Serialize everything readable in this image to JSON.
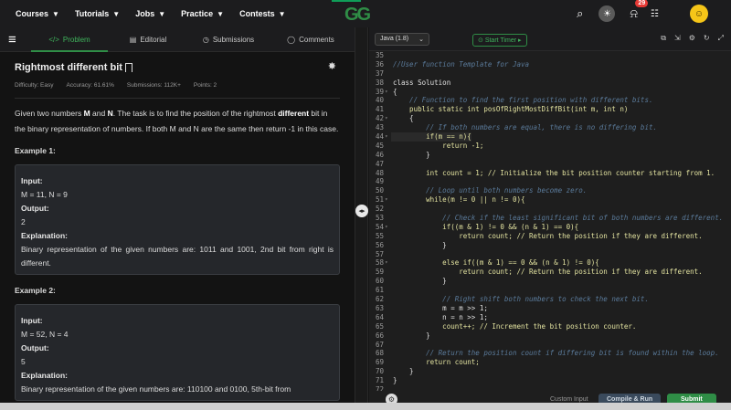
{
  "nav": {
    "items": [
      {
        "label": "Courses"
      },
      {
        "label": "Tutorials"
      },
      {
        "label": "Jobs"
      },
      {
        "label": "Practice"
      },
      {
        "label": "Contests"
      }
    ],
    "logo": "GG",
    "notifications_count": "29"
  },
  "problem": {
    "tabs": [
      {
        "label": "Problem"
      },
      {
        "label": "Editorial"
      },
      {
        "label": "Submissions"
      },
      {
        "label": "Comments"
      }
    ],
    "title": "Rightmost different bit",
    "difficulty": "Difficulty: Easy",
    "accuracy": "Accuracy: 61.61%",
    "submissions": "Submissions: 112K+",
    "points": "Points: 2",
    "description_parts": [
      "Given two numbers ",
      "M",
      " and ",
      "N",
      ". The task is to find the position of the rightmost ",
      "different",
      " bit in the binary representation of numbers. If both M and N are the same then return -1 in this case."
    ],
    "examples": [
      {
        "title": "Example 1:",
        "input_label": "Input:",
        "input": "M = 11, N = 9",
        "output_label": "Output:",
        "output": "2",
        "explanation_label": "Explanation:",
        "explanation": "Binary representation of the given numbers are: 1011 and 1001, 2nd bit from right is different."
      },
      {
        "title": "Example 2:",
        "input_label": "Input:",
        "input": "M = 52, N = 4",
        "output_label": "Output:",
        "output": "5",
        "explanation_label": "Explanation:",
        "explanation": "Binary representation of the given numbers are: 110100 and 0100, 5th-bit from"
      }
    ]
  },
  "editor": {
    "language": "Java (1.8)",
    "timer_label": "Start Timer",
    "custom_input": "Custom Input",
    "compile_label": "Compile & Run",
    "submit_label": "Submit",
    "lines": [
      {
        "n": "35",
        "f": "",
        "t": ""
      },
      {
        "n": "36",
        "f": "",
        "t": "//User function Template for Java",
        "c": "cm"
      },
      {
        "n": "37",
        "f": "",
        "t": ""
      },
      {
        "n": "38",
        "f": "",
        "t": "class Solution"
      },
      {
        "n": "39",
        "f": "▾",
        "t": "{"
      },
      {
        "n": "40",
        "f": "",
        "t": "    // Function to find the first position with different bits.",
        "c": "cm"
      },
      {
        "n": "41",
        "f": "",
        "t": "    public static int posOfRightMostDiffBit(int m, int n)",
        "c": "kw"
      },
      {
        "n": "42",
        "f": "▾",
        "t": "    {"
      },
      {
        "n": "43",
        "f": "",
        "t": "        // If both numbers are equal, there is no differing bit.",
        "c": "cm"
      },
      {
        "n": "44",
        "f": "▾",
        "t": "        if(m == n){",
        "c": "kw",
        "active": true
      },
      {
        "n": "45",
        "f": "",
        "t": "            return -1;",
        "c": "kw"
      },
      {
        "n": "46",
        "f": "",
        "t": "        }"
      },
      {
        "n": "47",
        "f": "",
        "t": ""
      },
      {
        "n": "48",
        "f": "",
        "t": "        int count = 1; // Initialize the bit position counter starting from 1.",
        "c": "kw"
      },
      {
        "n": "49",
        "f": "",
        "t": ""
      },
      {
        "n": "50",
        "f": "",
        "t": "        // Loop until both numbers become zero.",
        "c": "cm"
      },
      {
        "n": "51",
        "f": "▾",
        "t": "        while(m != 0 || n != 0){",
        "c": "kw"
      },
      {
        "n": "52",
        "f": "",
        "t": ""
      },
      {
        "n": "53",
        "f": "",
        "t": "            // Check if the least significant bit of both numbers are different.",
        "c": "cm"
      },
      {
        "n": "54",
        "f": "▾",
        "t": "            if((m & 1) != 0 && (n & 1) == 0){",
        "c": "kw"
      },
      {
        "n": "55",
        "f": "",
        "t": "                return count; // Return the position if they are different.",
        "c": "kw"
      },
      {
        "n": "56",
        "f": "",
        "t": "            }"
      },
      {
        "n": "57",
        "f": "",
        "t": ""
      },
      {
        "n": "58",
        "f": "▾",
        "t": "            else if((m & 1) == 0 && (n & 1) != 0){",
        "c": "kw"
      },
      {
        "n": "59",
        "f": "",
        "t": "                return count; // Return the position if they are different.",
        "c": "kw"
      },
      {
        "n": "60",
        "f": "",
        "t": "            }"
      },
      {
        "n": "61",
        "f": "",
        "t": ""
      },
      {
        "n": "62",
        "f": "",
        "t": "            // Right shift both numbers to check the next bit.",
        "c": "cm"
      },
      {
        "n": "63",
        "f": "",
        "t": "            m = m >> 1;"
      },
      {
        "n": "64",
        "f": "",
        "t": "            n = n >> 1;"
      },
      {
        "n": "65",
        "f": "",
        "t": "            count++; // Increment the bit position counter.",
        "c": "kw"
      },
      {
        "n": "66",
        "f": "",
        "t": "        }"
      },
      {
        "n": "67",
        "f": "",
        "t": ""
      },
      {
        "n": "68",
        "f": "",
        "t": "        // Return the position count if differing bit is found within the loop.",
        "c": "cm"
      },
      {
        "n": "69",
        "f": "",
        "t": "        return count;",
        "c": "kw"
      },
      {
        "n": "70",
        "f": "",
        "t": "    }"
      },
      {
        "n": "71",
        "f": "",
        "t": "}"
      },
      {
        "n": "72",
        "f": "",
        "t": ""
      }
    ]
  }
}
